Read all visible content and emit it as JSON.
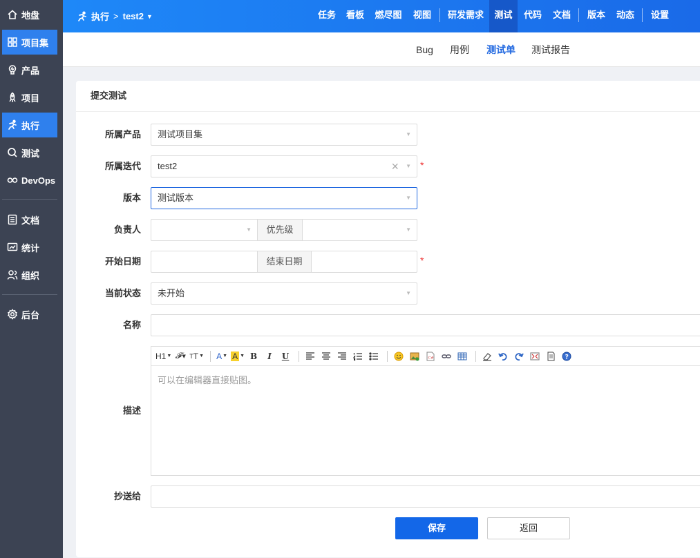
{
  "sidebar": {
    "items": [
      {
        "label": "地盘",
        "icon": "home-icon"
      },
      {
        "label": "项目集",
        "icon": "grid-icon"
      },
      {
        "label": "产品",
        "icon": "bulb-icon"
      },
      {
        "label": "项目",
        "icon": "rocket-icon"
      },
      {
        "label": "执行",
        "icon": "run-icon"
      },
      {
        "label": "测试",
        "icon": "search-icon"
      },
      {
        "label": "DevOps",
        "icon": "infinity-icon"
      },
      {
        "label": "文档",
        "icon": "doc-icon"
      },
      {
        "label": "统计",
        "icon": "chart-icon"
      },
      {
        "label": "组织",
        "icon": "users-icon"
      },
      {
        "label": "后台",
        "icon": "gear-icon"
      }
    ]
  },
  "header": {
    "crumb_module": "执行",
    "crumb_separator": ">",
    "crumb_project": "test2",
    "nav": [
      "任务",
      "看板",
      "燃尽图",
      "视图",
      "研发需求",
      "测试",
      "代码",
      "文档",
      "版本",
      "动态",
      "设置"
    ]
  },
  "subnav": [
    "Bug",
    "用例",
    "测试单",
    "测试报告"
  ],
  "form": {
    "title": "提交测试",
    "product_label": "所属产品",
    "product_value": "测试项目集",
    "iteration_label": "所属迭代",
    "iteration_value": "test2",
    "build_label": "版本",
    "build_value": "测试版本",
    "owner_label": "负责人",
    "owner_value": "",
    "priority_label": "优先级",
    "priority_value": "",
    "begin_label": "开始日期",
    "begin_value": "",
    "end_label": "结束日期",
    "end_value": "",
    "status_label": "当前状态",
    "status_value": "未开始",
    "name_label": "名称",
    "name_value": "",
    "desc_label": "描述",
    "desc_placeholder": "可以在编辑器直接贴图。",
    "cc_label": "抄送给",
    "cc_value": "",
    "required_mark": "*",
    "save_label": "保存",
    "back_label": "返回"
  },
  "colors": {
    "accent": "#1367e8",
    "sidebar": "#3c4353",
    "required": "#e33333"
  }
}
